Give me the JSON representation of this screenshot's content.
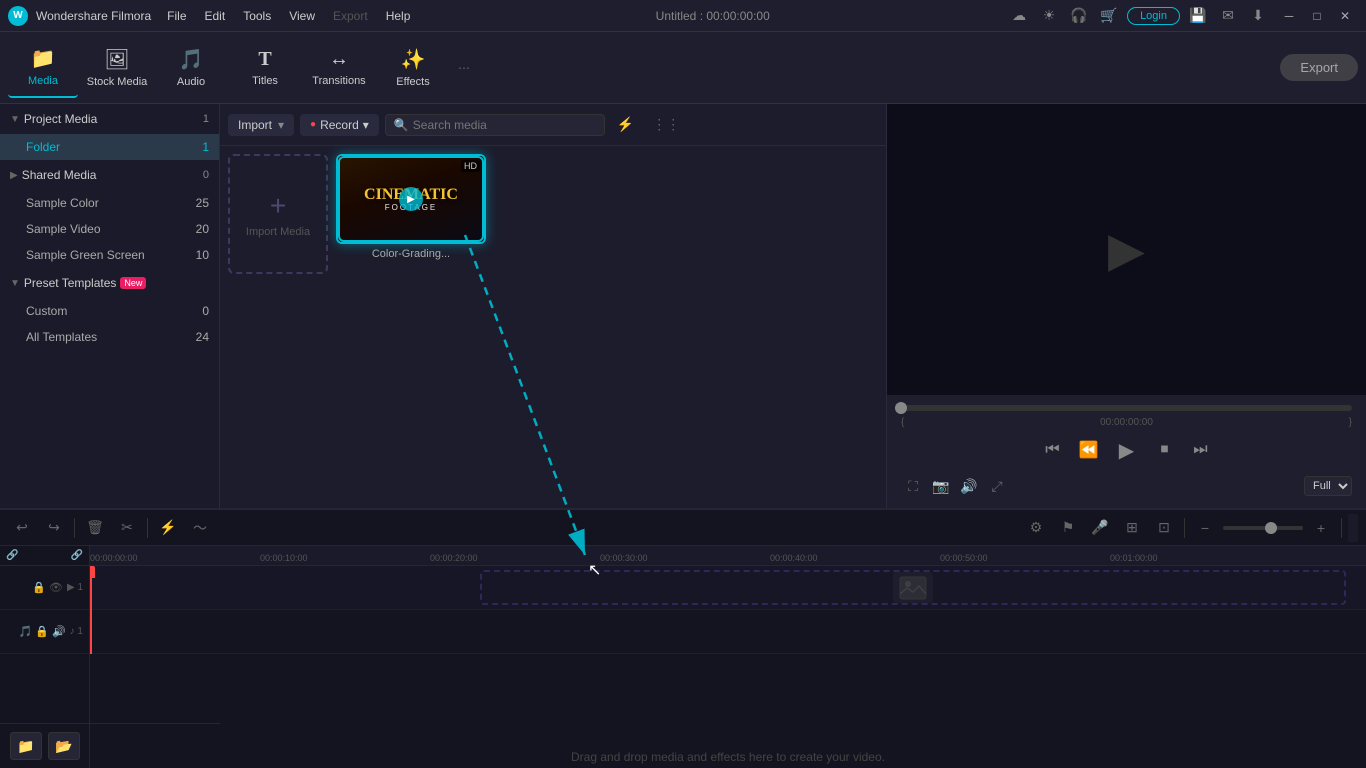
{
  "app": {
    "name": "Wondershare Filmora",
    "logo": "W",
    "title": "Untitled : 00:00:00:00"
  },
  "titlebar": {
    "menu": [
      "File",
      "Edit",
      "Tools",
      "View",
      "Export",
      "Help"
    ],
    "export_label": "Export",
    "login_label": "Login"
  },
  "toolbar": {
    "items": [
      {
        "id": "media",
        "label": "Media",
        "icon": "🎬",
        "active": true
      },
      {
        "id": "stock",
        "label": "Stock Media",
        "icon": "🖼",
        "active": false
      },
      {
        "id": "audio",
        "label": "Audio",
        "icon": "🎵",
        "active": false
      },
      {
        "id": "titles",
        "label": "Titles",
        "icon": "T",
        "active": false
      },
      {
        "id": "transitions",
        "label": "Transitions",
        "icon": "↔",
        "active": false
      },
      {
        "id": "effects",
        "label": "Effects",
        "icon": "✨",
        "active": false
      }
    ]
  },
  "sidebar": {
    "project_media": {
      "label": "Project Media",
      "count": 1,
      "expanded": true
    },
    "items_top": [
      {
        "id": "folder",
        "label": "Folder",
        "count": 1,
        "active": true
      }
    ],
    "shared_media": {
      "label": "Shared Media",
      "count": 0,
      "expanded": false
    },
    "items_shared": [
      {
        "id": "sample-color",
        "label": "Sample Color",
        "count": 25
      },
      {
        "id": "sample-video",
        "label": "Sample Video",
        "count": 20
      },
      {
        "id": "sample-green",
        "label": "Sample Green Screen",
        "count": 10
      }
    ],
    "preset_templates": {
      "label": "Preset Templates",
      "badge": "New",
      "expanded": true
    },
    "items_preset": [
      {
        "id": "custom",
        "label": "Custom",
        "count": 0
      },
      {
        "id": "all-templates",
        "label": "All Templates",
        "count": 24
      }
    ]
  },
  "media_toolbar": {
    "import_label": "Import",
    "record_label": "Record",
    "search_placeholder": "Search media"
  },
  "media_item": {
    "label": "Color-Grading...",
    "badge": "HD"
  },
  "import_area": {
    "label": "Import Media"
  },
  "preview": {
    "time": "00:00:00:00",
    "quality": "Full",
    "btns": {
      "skip_back": "⏮",
      "step_back": "⏪",
      "play": "▶",
      "stop": "⏹",
      "skip_fwd": "⏭"
    }
  },
  "timeline": {
    "markers": [
      "00:00:00:00",
      "00:00:10:00",
      "00:00:20:00",
      "00:00:30:00",
      "00:00:40:00",
      "00:00:50:00",
      "00:01:00:00"
    ],
    "drop_text": "Drag and drop media and effects here to create your video.",
    "tracks": [
      {
        "type": "video",
        "num": "1",
        "icons": [
          "🔒",
          "👁"
        ]
      },
      {
        "type": "audio",
        "num": "1",
        "icons": [
          "🎵",
          "🔒",
          "🔊"
        ]
      }
    ]
  },
  "bottom_toolbar": {
    "undo": "↩",
    "redo": "↪",
    "delete": "🗑",
    "cut": "✂",
    "split": "⚡",
    "audio_wave": "〜"
  }
}
